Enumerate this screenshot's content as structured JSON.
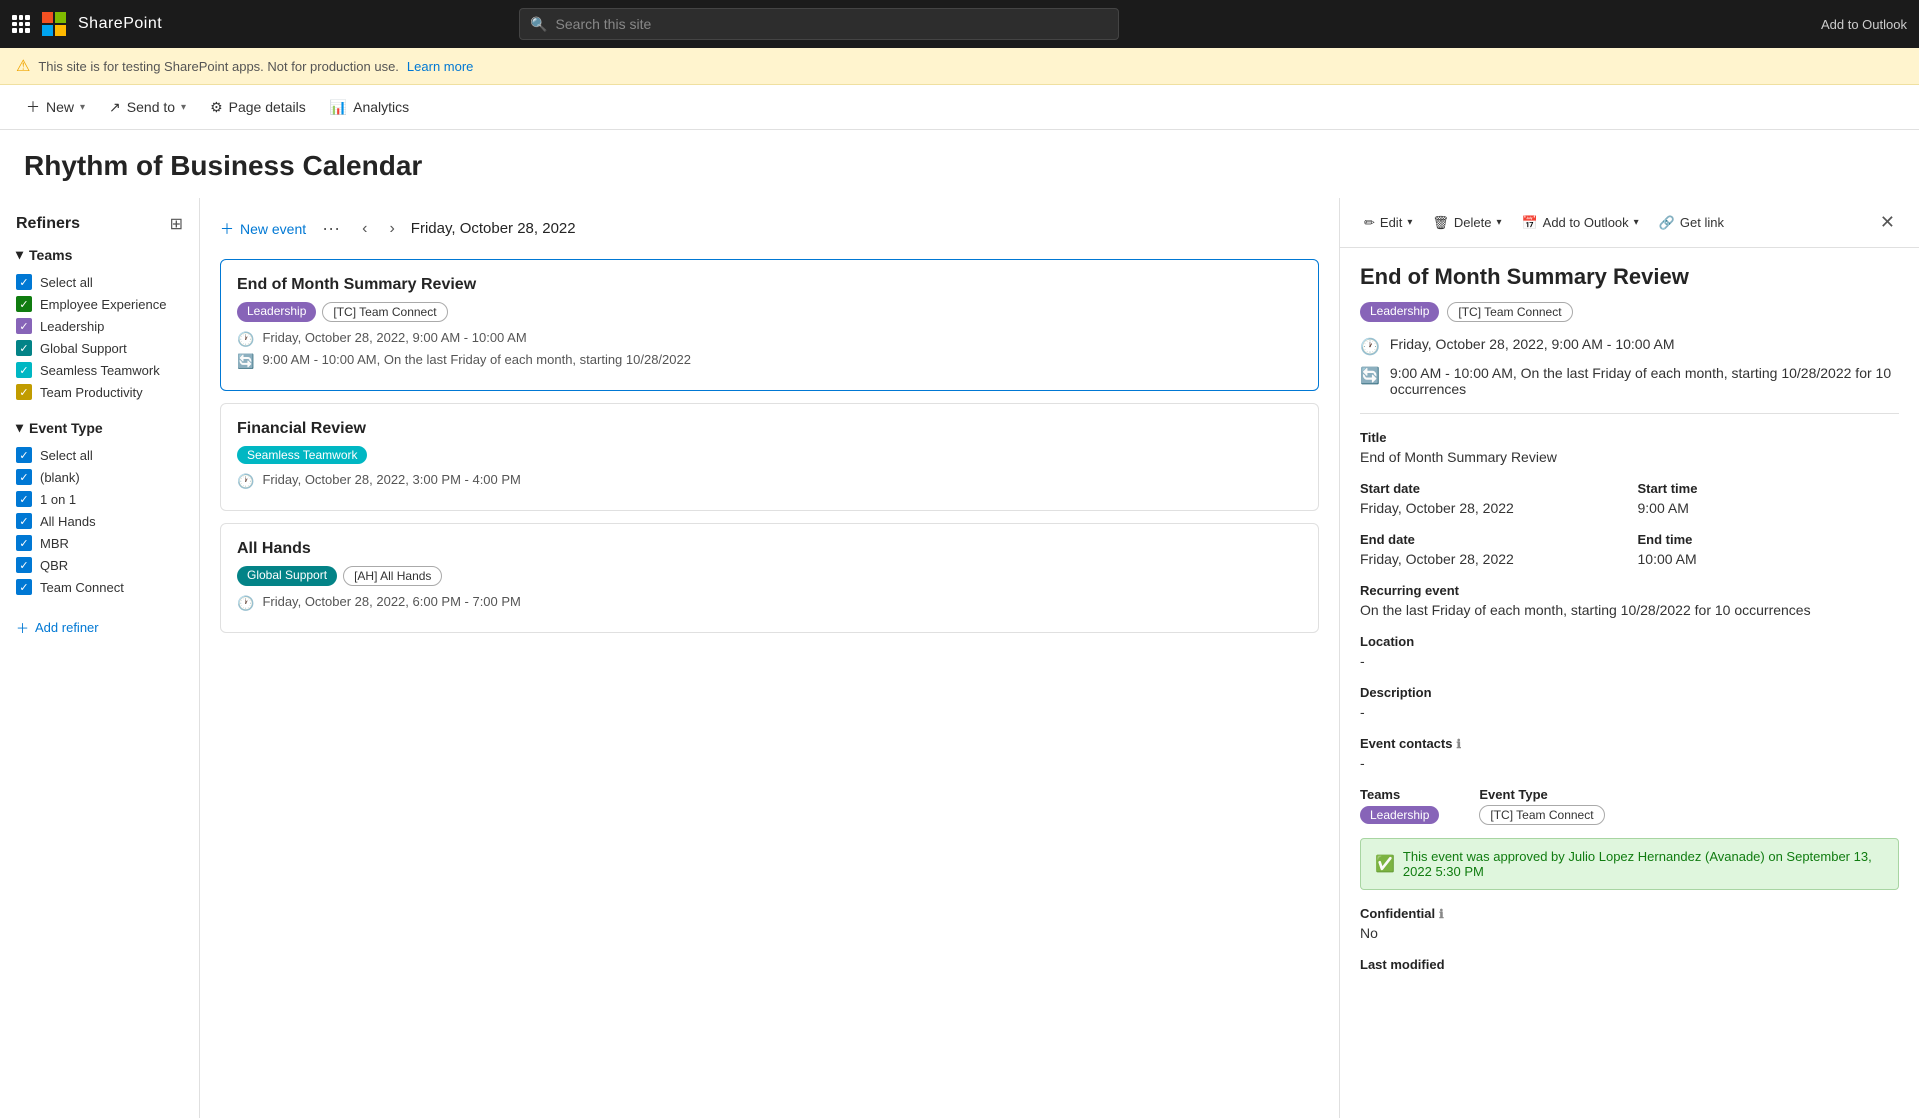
{
  "topNav": {
    "brand": "SharePoint",
    "searchPlaceholder": "Search this site"
  },
  "warningBar": {
    "text": "This site is for testing SharePoint apps. Not for production use.",
    "linkText": "Learn more"
  },
  "toolbar": {
    "newLabel": "New",
    "sendToLabel": "Send to",
    "pageDetailsLabel": "Page details",
    "analyticsLabel": "Analytics"
  },
  "pageTitle": "Rhythm of Business Calendar",
  "refiners": {
    "title": "Refiners",
    "teamsSection": {
      "label": "Teams",
      "items": [
        {
          "name": "Select all",
          "color": "cb-blue"
        },
        {
          "name": "Employee Experience",
          "color": "cb-green"
        },
        {
          "name": "Leadership",
          "color": "cb-purple"
        },
        {
          "name": "Global Support",
          "color": "cb-teal"
        },
        {
          "name": "Seamless Teamwork",
          "color": "cb-seamless"
        },
        {
          "name": "Team Productivity",
          "color": "cb-yellow"
        }
      ]
    },
    "eventTypeSection": {
      "label": "Event Type",
      "items": [
        {
          "name": "Select all",
          "color": "cb-blue"
        },
        {
          "name": "(blank)",
          "color": "cb-blue"
        },
        {
          "name": "1 on 1",
          "color": "cb-blue"
        },
        {
          "name": "All Hands",
          "color": "cb-blue"
        },
        {
          "name": "MBR",
          "color": "cb-blue"
        },
        {
          "name": "QBR",
          "color": "cb-blue"
        },
        {
          "name": "Team Connect",
          "color": "cb-blue"
        }
      ]
    },
    "addRefinerLabel": "Add refiner"
  },
  "calendar": {
    "newEventLabel": "New event",
    "currentDate": "Friday, October 28, 2022",
    "events": [
      {
        "id": 1,
        "title": "End of Month Summary Review",
        "tags": [
          {
            "label": "Leadership",
            "class": "tag-leadership"
          },
          {
            "label": "[TC] Team Connect",
            "class": "tag-tc"
          }
        ],
        "dateTime": "Friday, October 28, 2022, 9:00 AM - 10:00 AM",
        "recurrence": "9:00 AM - 10:00 AM, On the last Friday of each month, starting 10/28/2022",
        "selected": true
      },
      {
        "id": 2,
        "title": "Financial Review",
        "tags": [
          {
            "label": "Seamless Teamwork",
            "class": "tag-seamless"
          }
        ],
        "dateTime": "Friday, October 28, 2022, 3:00 PM - 4:00 PM",
        "recurrence": null,
        "selected": false
      },
      {
        "id": 3,
        "title": "All Hands",
        "tags": [
          {
            "label": "Global Support",
            "class": "tag-global"
          },
          {
            "label": "[AH] All Hands",
            "class": "tag-allhands"
          }
        ],
        "dateTime": "Friday, October 28, 2022, 6:00 PM - 7:00 PM",
        "recurrence": null,
        "selected": false
      }
    ]
  },
  "detail": {
    "toolbar": {
      "editLabel": "Edit",
      "deleteLabel": "Delete",
      "addToOutlookLabel": "Add to Outlook",
      "getLinkLabel": "Get link"
    },
    "title": "End of Month Summary Review",
    "tags": [
      {
        "label": "Leadership",
        "class": "tag-leadership"
      },
      {
        "label": "[TC] Team Connect",
        "class": "tag-tc"
      }
    ],
    "primaryTime": "Friday, October 28, 2022, 9:00 AM - 10:00 AM",
    "recurrenceTime": "9:00 AM - 10:00 AM, On the last Friday of each month, starting 10/28/2022 for 10 occurrences",
    "fields": {
      "titleLabel": "Title",
      "titleValue": "End of Month Summary Review",
      "startDateLabel": "Start date",
      "startDateValue": "Friday, October 28, 2022",
      "startTimeLabel": "Start time",
      "startTimeValue": "9:00 AM",
      "endDateLabel": "End date",
      "endDateValue": "Friday, October 28, 2022",
      "endTimeLabel": "End time",
      "endTimeValue": "10:00 AM",
      "recurringLabel": "Recurring event",
      "recurringValue": "On the last Friday of each month, starting 10/28/2022 for 10 occurrences",
      "locationLabel": "Location",
      "locationValue": "-",
      "descriptionLabel": "Description",
      "descriptionValue": "-",
      "eventContactsLabel": "Event contacts",
      "eventContactsValue": "-",
      "teamsLabel": "Teams",
      "eventTypeLabel": "Event Type",
      "teamsValue": "Leadership",
      "eventTypeValue": "[TC] Team Connect",
      "confidentialLabel": "Confidential",
      "confidentialValue": "No",
      "lastModifiedLabel": "Last modified"
    },
    "approvalText": "This event was approved by Julio Lopez Hernandez (Avanade) on September 13, 2022 5:30 PM"
  }
}
